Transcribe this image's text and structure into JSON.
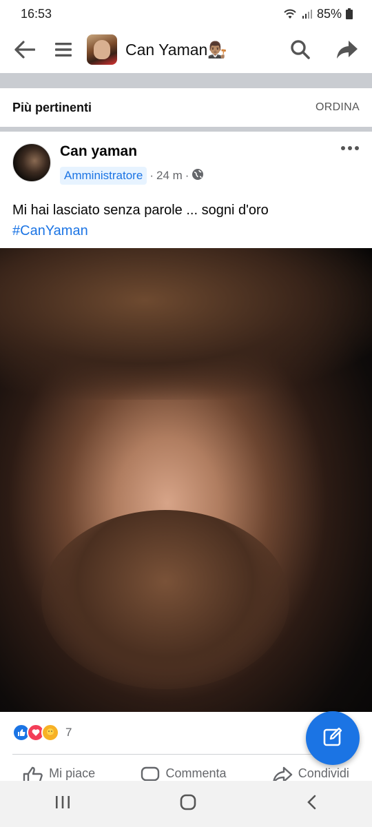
{
  "status_bar": {
    "time": "16:53",
    "battery": "85%"
  },
  "header": {
    "group_title": "Can Yaman👨🏽‍⚖️",
    "icons": [
      "back-arrow-icon",
      "menu-icon",
      "search-icon",
      "share-icon"
    ]
  },
  "sort": {
    "title": "Più pertinenti",
    "action": "ORDINA"
  },
  "post": {
    "author": "Can yaman",
    "role": "Amministratore",
    "time": "24 m",
    "visibility_icon": "globe-icon",
    "text": "Mi hai lasciato senza parole ... sogni d'oro",
    "hashtag": "#CanYaman",
    "reactions": {
      "icons": [
        "like-icon",
        "love-icon",
        "care-icon"
      ],
      "count": "7"
    },
    "actions": {
      "like": "Mi piace",
      "comment": "Commenta",
      "share": "Condividi"
    }
  },
  "colors": {
    "accent": "#1b74e4",
    "badge_bg": "#e7f3ff",
    "divider": "#c9ccd1",
    "muted_text": "#65676b"
  }
}
